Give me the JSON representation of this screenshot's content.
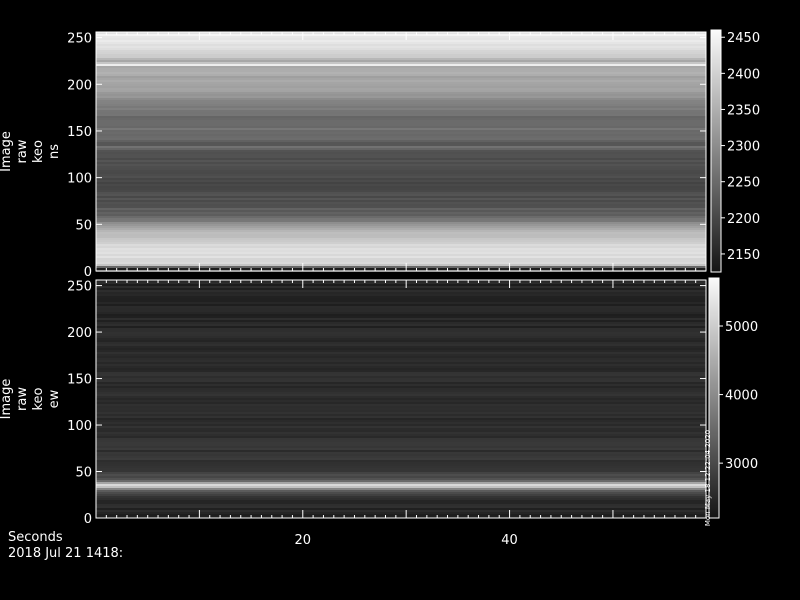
{
  "chart_data": [
    {
      "type": "heatmap",
      "ylabel_lines": [
        "Image",
        "raw",
        "keo",
        "ns"
      ],
      "xlim": [
        0,
        59
      ],
      "ylim": [
        0,
        256
      ],
      "y_ticks": [
        0,
        50,
        100,
        150,
        200,
        250
      ],
      "colorbar": {
        "range": [
          2125,
          2460
        ],
        "ticks": [
          2150,
          2200,
          2250,
          2300,
          2350,
          2400,
          2450
        ]
      },
      "row_profile": {
        "y": [
          0,
          3,
          6,
          10,
          20,
          30,
          40,
          50,
          60,
          70,
          80,
          90,
          100,
          110,
          120,
          130,
          132,
          134,
          140,
          150,
          160,
          170,
          180,
          190,
          200,
          210,
          215,
          218,
          221,
          224,
          228,
          240,
          250,
          256
        ],
        "values": [
          2180,
          2140,
          2390,
          2410,
          2420,
          2410,
          2370,
          2300,
          2240,
          2220,
          2210,
          2200,
          2200,
          2205,
          2210,
          2220,
          2300,
          2220,
          2240,
          2260,
          2250,
          2260,
          2290,
          2320,
          2330,
          2340,
          2350,
          2330,
          2450,
          2330,
          2380,
          2420,
          2440,
          2440
        ]
      }
    },
    {
      "type": "heatmap",
      "ylabel_lines": [
        "Image",
        "raw",
        "keo",
        "ew"
      ],
      "xlim": [
        0,
        59
      ],
      "ylim": [
        0,
        256
      ],
      "y_ticks": [
        0,
        50,
        100,
        150,
        200,
        250
      ],
      "colorbar": {
        "range": [
          2200,
          5700
        ],
        "ticks": [
          3000,
          4000,
          5000
        ]
      },
      "side_text": "Mon May 18 12:22:04 2020",
      "row_profile": {
        "y": [
          0,
          5,
          10,
          15,
          20,
          25,
          28,
          31,
          33,
          34,
          35,
          36,
          38,
          40,
          43,
          46,
          50,
          55,
          60,
          70,
          80,
          90,
          100,
          120,
          140,
          160,
          180,
          200,
          220,
          240,
          256
        ],
        "values": [
          2450,
          2460,
          2480,
          2520,
          2600,
          2800,
          3100,
          3700,
          4600,
          5300,
          5400,
          5100,
          4200,
          3500,
          3100,
          2950,
          2850,
          2780,
          2720,
          2680,
          2650,
          2620,
          2600,
          2580,
          2560,
          2540,
          2520,
          2500,
          2480,
          2460,
          2450
        ]
      }
    }
  ],
  "x_axis": {
    "ticks": [
      20,
      40
    ]
  },
  "footer": {
    "label": "Seconds",
    "date": "2018 Jul 21 1418:"
  }
}
